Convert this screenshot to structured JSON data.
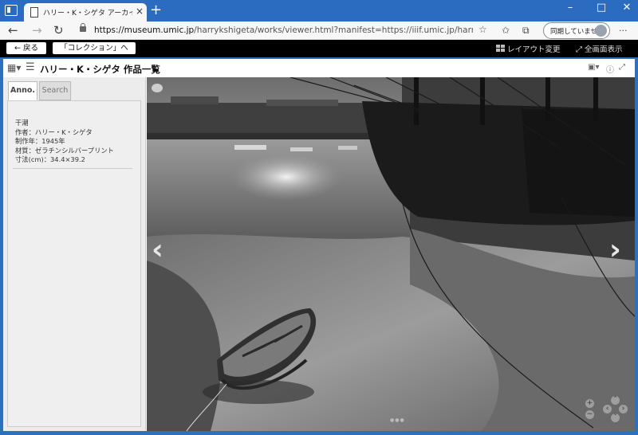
{
  "browser": {
    "tab_title": "ハリー・K・シゲタ アーカイブズ | 作品ビ",
    "tab_close": "×",
    "new_tab": "+",
    "window_controls": {
      "minimize": "–",
      "maximize": "□",
      "close": "✕"
    },
    "url_host": "https://museum.umic.jp",
    "url_path": "/harrykshigeta/works/viewer.html?manifest=https://iiif.umic.jp/harrykshigeta/w...",
    "sync_label": "同期していません",
    "icons": {
      "back": "←",
      "forward": "→",
      "refresh": "↻",
      "favorite": "☆",
      "favorites_bar": "✩",
      "collections": "⧉",
      "more": "···"
    }
  },
  "toolbar": {
    "back_label": "← 戻る",
    "collection_label": "「コレクション」へ",
    "layout_label": "レイアウト変更",
    "fullscreen_label": "全画面表示"
  },
  "viewer": {
    "title": "ハリー・K・シゲタ 作品一覧",
    "tabs": [
      "Anno.",
      "Search"
    ],
    "metadata": [
      "干潮",
      "作者：ハリー・K・シゲタ",
      "制作年：1945年",
      "材質：ゼラチンシルバープリント",
      "寸法(cm)：34.4×39.2"
    ],
    "page_dots": "●●●",
    "zoom_in": "+",
    "zoom_out": "−"
  },
  "colors": {
    "chrome_blue": "#2b6bc0",
    "toolbar_black": "#000000",
    "panel_gray": "#ececec"
  }
}
